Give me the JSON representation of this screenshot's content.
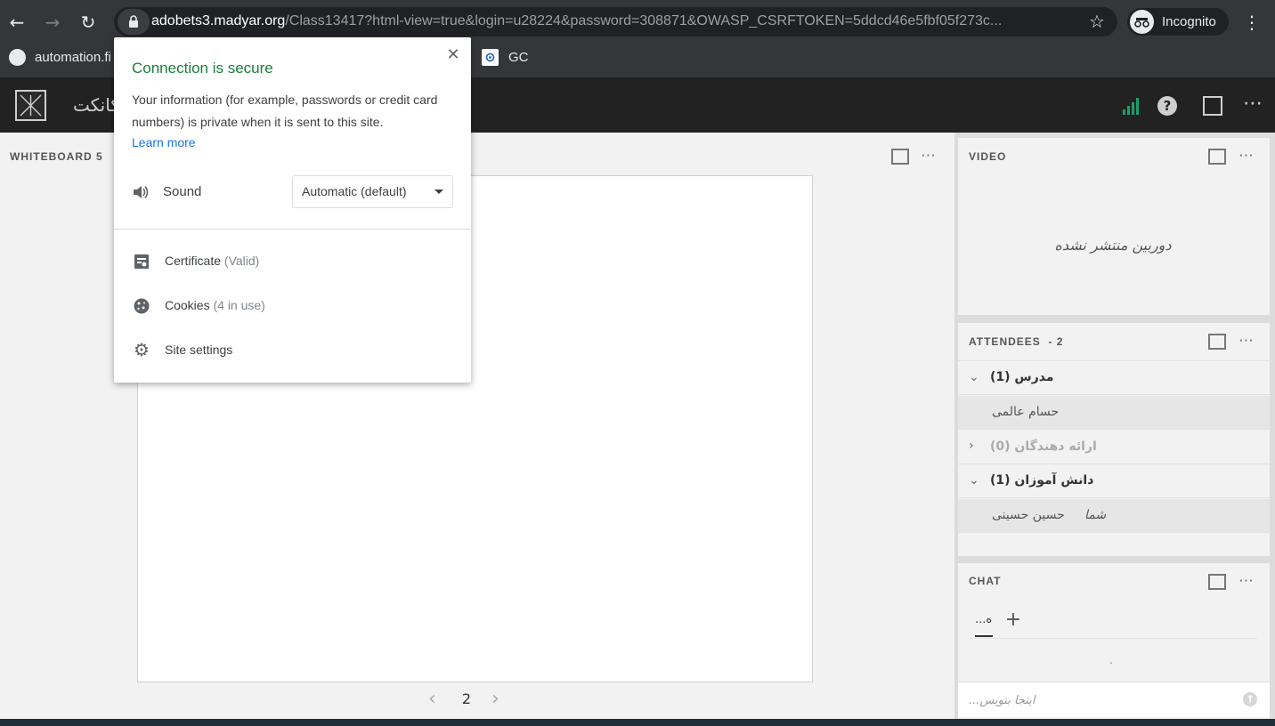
{
  "browser": {
    "url_host": "adobets3.madyar.org",
    "url_path": "/Class13417?html-view=true&login=u28224&password=308871&OWASP_CSRFTOKEN=5ddcd46e5fbf05f273c...",
    "incognito_label": "Incognito",
    "bookmarks": [
      "automation.fi",
      "GC"
    ]
  },
  "app": {
    "title": "کانکت"
  },
  "whiteboard": {
    "title": "WHITEBOARD 5",
    "page": "2"
  },
  "video": {
    "title": "VIDEO",
    "message": "دوربین منتشر نشده"
  },
  "attendees": {
    "title": "ATTENDEES  - 2",
    "groups": [
      {
        "label": "مدرس (1)",
        "expanded": true
      },
      {
        "label": "ارائه دهندگان (0)",
        "expanded": false
      },
      {
        "label": "دانش آموزان (1)",
        "expanded": true
      }
    ],
    "people": [
      "حسام عالمی",
      "حسین حسینی",
      "شما"
    ]
  },
  "chat": {
    "title": "CHAT",
    "tab_label": "...ه",
    "dot": ".",
    "placeholder": "اینجا بنویس..."
  },
  "popup": {
    "title": "Connection is secure",
    "description": "Your information (for example, passwords or credit card numbers) is private when it is sent to this site.",
    "learn_more": "Learn more",
    "sound_label": "Sound",
    "sound_value": "Automatic (default)",
    "certificate_label": "Certificate",
    "certificate_status": "(Valid)",
    "cookies_label": "Cookies",
    "cookies_status": "(4 in use)",
    "site_settings_label": "Site settings"
  },
  "colors": {
    "secure_green": "#188038",
    "link_blue": "#1a73e8",
    "signal_green": "#1e9e6a"
  }
}
